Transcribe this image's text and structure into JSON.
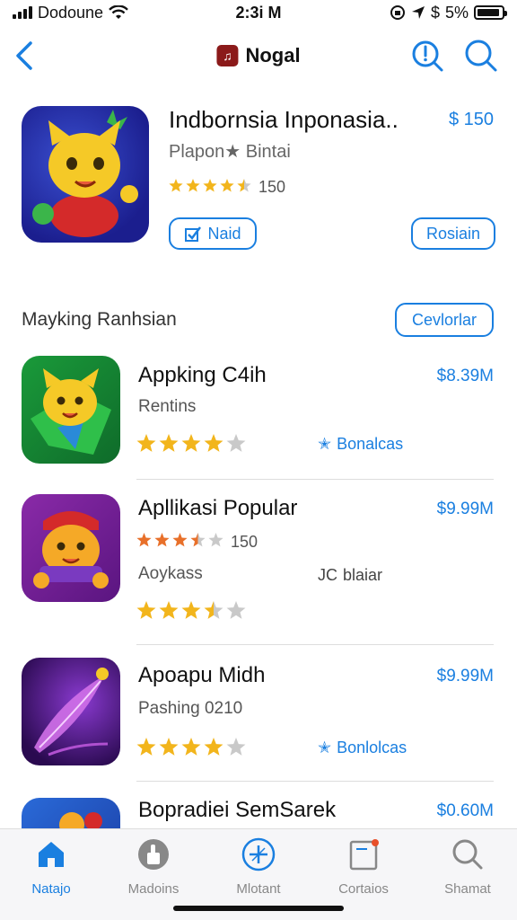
{
  "status": {
    "carrier": "Dodoune",
    "time": "2:3i M",
    "battery": "5%",
    "signal_glyph": "$"
  },
  "nav": {
    "title": "Nogal"
  },
  "featured": {
    "name": "Indbornsia Inponasia..",
    "price": "$ 150",
    "subtitle": "Plapon★ Bintai",
    "rating": 4.5,
    "rating_count": "150",
    "left_button": "Naid",
    "right_button": "Rosiain"
  },
  "section": {
    "title": "Mayking Ranhsian",
    "button": "Cevlorlar"
  },
  "apps": [
    {
      "name": "Appking C4ih",
      "price": "$8.39M",
      "subtitle": "Rentins",
      "rating": 4.0,
      "meta": "Bonalcas",
      "colors": [
        "#1a9a3a",
        "#0f6b2a"
      ]
    },
    {
      "name": "Apllikasi Popular",
      "price": "$9.99M",
      "rating_small": 3.5,
      "rating_small_label": "150",
      "subtitle": "Aoykass",
      "meta": "blaiar",
      "meta_prefix": "JC",
      "rating": 3.5,
      "colors": [
        "#8a2aa8",
        "#5a1580"
      ]
    },
    {
      "name": "Apoapu Midh",
      "price": "$9.99M",
      "subtitle": "Pashing 0210",
      "rating": 4.0,
      "meta": "Bonlolcas",
      "colors": [
        "#5a1890",
        "#2a0a50"
      ]
    },
    {
      "name": "Bopradiei SemSarek",
      "price": "$0.60M"
    }
  ],
  "tabs": [
    {
      "label": "Natajo",
      "icon": "home-icon",
      "active": true
    },
    {
      "label": "Madoins",
      "icon": "thumbs-up-icon",
      "active": false
    },
    {
      "label": "Mlotant",
      "icon": "compass-icon",
      "active": false
    },
    {
      "label": "Cortaios",
      "icon": "note-icon",
      "active": false
    },
    {
      "label": "Shamat",
      "icon": "search-icon",
      "active": false
    }
  ],
  "colors": {
    "accent": "#1a7fe0",
    "star": "#f2b51c",
    "star_empty": "#c9c9c9"
  }
}
